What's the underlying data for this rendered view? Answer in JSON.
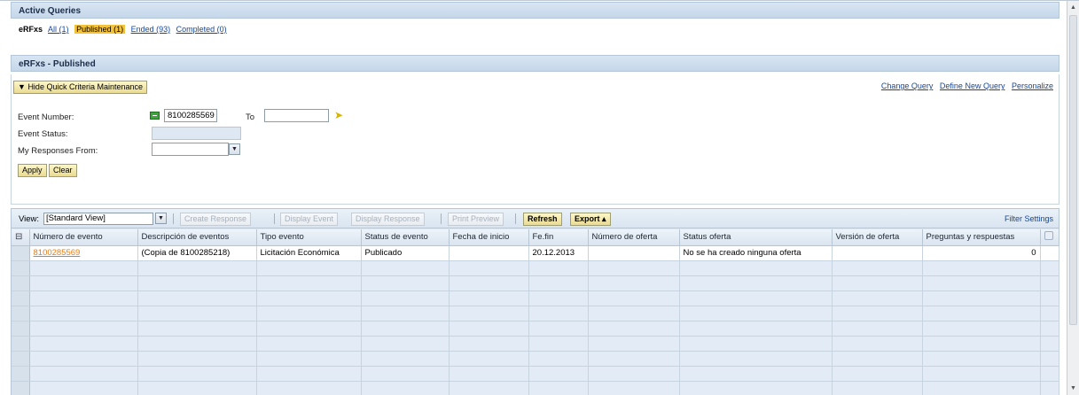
{
  "active_queries": {
    "title": "Active Queries",
    "label": "eRFxs",
    "links": [
      "All (1)",
      "Published (1)",
      "Ended (93)",
      "Completed (0)"
    ]
  },
  "section": {
    "title": "eRFxs - Published",
    "hide_criteria_label": "Hide Quick Criteria Maintenance",
    "links": [
      "Change Query",
      "Define New Query",
      "Personalize"
    ],
    "form": {
      "event_number_label": "Event Number:",
      "event_number_value": "8100285569",
      "to_label": "To",
      "to_value": "",
      "event_status_label": "Event Status:",
      "event_status_value": "",
      "responses_from_label": "My Responses From:",
      "responses_from_value": ""
    },
    "apply_label": "Apply",
    "clear_label": "Clear"
  },
  "toolbar": {
    "view_label": "View:",
    "view_value": "[Standard View]",
    "create_response": "Create Response",
    "display_event": "Display Event",
    "display_response": "Display Response",
    "print_preview": "Print Preview",
    "refresh": "Refresh",
    "export": "Export ▴",
    "filter_settings": "Filter Settings"
  },
  "table": {
    "columns": [
      "Número de evento",
      "Descripción de eventos",
      "Tipo evento",
      "Status de evento",
      "Fecha de inicio",
      "Fe.fin",
      "Número de oferta",
      "Status oferta",
      "Versión de oferta",
      "Preguntas y respuestas"
    ],
    "rows": [
      [
        "8100285569",
        "(Copia de 8100285218)",
        "Licitación Económica",
        "Publicado",
        "",
        "20.12.2013",
        "",
        "No se ha creado ninguna oferta",
        "",
        "0"
      ]
    ]
  }
}
